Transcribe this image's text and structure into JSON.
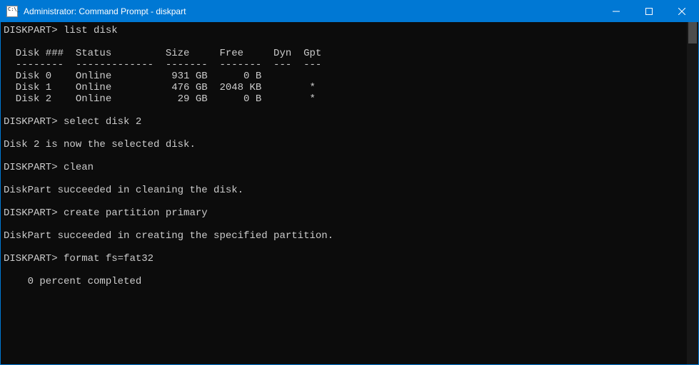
{
  "titlebar": {
    "title": "Administrator: Command Prompt - diskpart"
  },
  "terminal": {
    "prompt": "DISKPART>",
    "commands": {
      "list_disk": "list disk",
      "select_disk": "select disk 2",
      "clean": "clean",
      "create_partition": "create partition primary",
      "format": "format fs=fat32"
    },
    "table": {
      "header": "  Disk ###  Status         Size     Free     Dyn  Gpt",
      "divider": "  --------  -------------  -------  -------  ---  ---",
      "rows": [
        "  Disk 0    Online          931 GB      0 B",
        "  Disk 1    Online          476 GB  2048 KB        *",
        "  Disk 2    Online           29 GB      0 B        *"
      ]
    },
    "responses": {
      "selected": "Disk 2 is now the selected disk.",
      "cleaned": "DiskPart succeeded in cleaning the disk.",
      "partition_created": "DiskPart succeeded in creating the specified partition.",
      "format_progress": "    0 percent completed"
    }
  }
}
